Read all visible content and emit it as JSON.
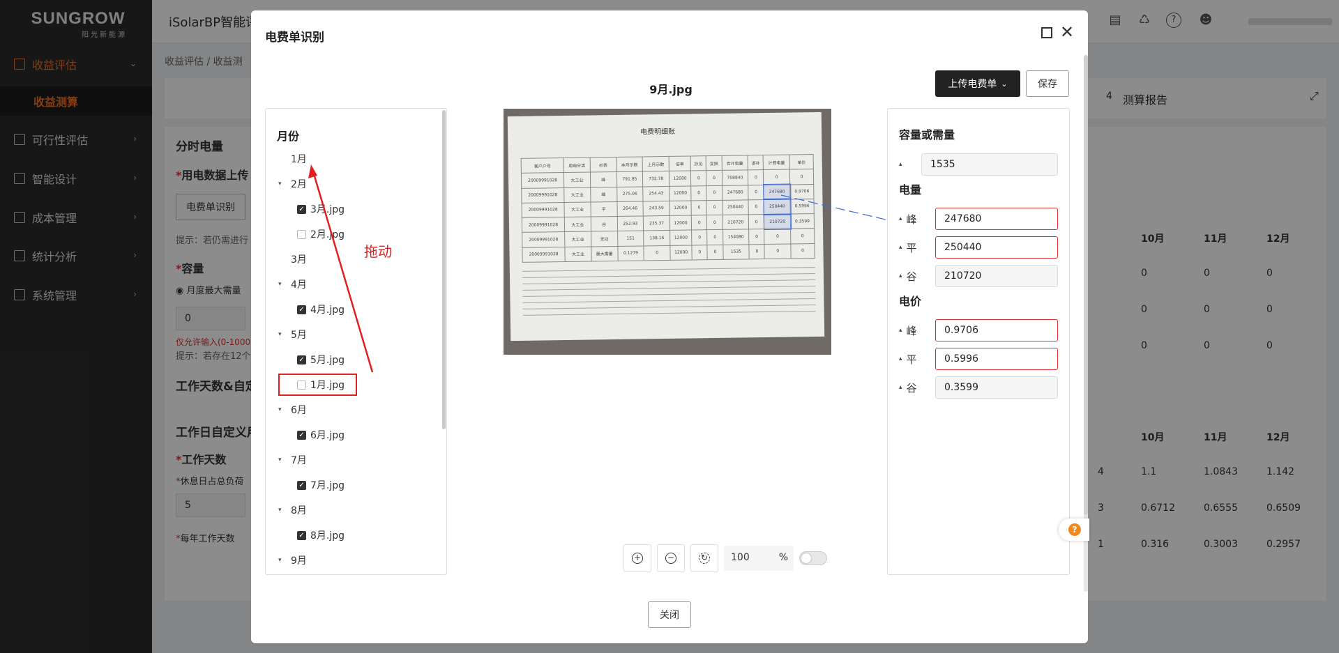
{
  "brand": {
    "name": "SUNGROW",
    "sub": "阳光新能源"
  },
  "sidebar": {
    "items": [
      {
        "label": "收益评估",
        "active": true
      },
      {
        "label": "可行性评估"
      },
      {
        "label": "智能设计"
      },
      {
        "label": "成本管理"
      },
      {
        "label": "统计分析"
      },
      {
        "label": "系统管理"
      }
    ],
    "subitem": "收益测算"
  },
  "header": {
    "app_title": "iSolarBP智能评估"
  },
  "background": {
    "breadcrumb": "收益评估  /  收益测",
    "step_label": "4",
    "step_title": "测算报告",
    "section_tou": "分时电量",
    "label_upload": "用电数据上传",
    "btn_bill": "电费单识别",
    "hint_retry": "提示：若仍需进行",
    "label_capacity": "容量",
    "radio_label": "月度最大需量",
    "capacity_value": "0",
    "err_range": "仅允许输入(0-1000",
    "hint_exists": "提示：若存在12个",
    "section_workdays": "工作天数&自定",
    "section_custom": "工作日自定义用",
    "label_workdays": "工作天数",
    "label_rest": "休息日占总负荷",
    "rest_value": "5",
    "label_yearly": "每年工作天数",
    "table1": {
      "headers": [
        "10月",
        "11月",
        "12月"
      ],
      "rows": [
        [
          "0",
          "0",
          "0"
        ],
        [
          "0",
          "0",
          "0"
        ],
        [
          "0",
          "0",
          "0"
        ]
      ]
    },
    "table2": {
      "headers": [
        "10月",
        "11月",
        "12月"
      ],
      "rows": [
        [
          "4",
          "1.1",
          "1.0843",
          "1.142"
        ],
        [
          "3",
          "0.6712",
          "0.6555",
          "0.6509"
        ],
        [
          "1",
          "0.316",
          "0.3003",
          "0.2957"
        ]
      ]
    }
  },
  "modal": {
    "title": "电费单识别",
    "upload_label": "上传电费单",
    "save_label": "保存",
    "close_label": "关闭",
    "image_name": "9月.jpg",
    "zoom_value": "100",
    "zoom_unit": "%",
    "tree": {
      "heading": "月份",
      "rows": [
        {
          "label": "1月",
          "type": "leaf-month"
        },
        {
          "label": "2月",
          "type": "group"
        },
        {
          "label": "3月.jpg",
          "type": "file",
          "checked": true
        },
        {
          "label": "2月.jpg",
          "type": "file",
          "checked": false
        },
        {
          "label": "3月",
          "type": "leaf-month"
        },
        {
          "label": "4月",
          "type": "group"
        },
        {
          "label": "4月.jpg",
          "type": "file",
          "checked": true
        },
        {
          "label": "5月",
          "type": "group"
        },
        {
          "label": "5月.jpg",
          "type": "file",
          "checked": true
        },
        {
          "label": "1月.jpg",
          "type": "file",
          "checked": false
        },
        {
          "label": "6月",
          "type": "group"
        },
        {
          "label": "6月.jpg",
          "type": "file",
          "checked": true
        },
        {
          "label": "7月",
          "type": "group"
        },
        {
          "label": "7月.jpg",
          "type": "file",
          "checked": true
        },
        {
          "label": "8月",
          "type": "group"
        },
        {
          "label": "8月.jpg",
          "type": "file",
          "checked": true
        },
        {
          "label": "9月",
          "type": "group"
        }
      ]
    },
    "right": {
      "capacity_heading": "容量或需量",
      "capacity_value": "1535",
      "energy_heading": "电量",
      "energy": [
        {
          "label": "峰",
          "value": "247680",
          "error": true
        },
        {
          "label": "平",
          "value": "250440",
          "error": true
        },
        {
          "label": "谷",
          "value": "210720",
          "error": false
        }
      ],
      "price_heading": "电价",
      "price": [
        {
          "label": "峰",
          "value": "0.9706",
          "error": true
        },
        {
          "label": "平",
          "value": "0.5996",
          "error": true
        },
        {
          "label": "谷",
          "value": "0.3599",
          "error": false
        }
      ]
    },
    "bill": {
      "title": "电费明细账",
      "rows": [
        [
          "客户户号",
          "用电分类",
          "抄表",
          "本月示数",
          "上月示数",
          "倍率",
          "抄见",
          "变损",
          "合计电量",
          "退补",
          "计费电量",
          "单价"
        ],
        [
          "20009991028",
          "大工业",
          "峰",
          "791.85",
          "732.78",
          "12000",
          "0",
          "0",
          "708840",
          "0",
          "0",
          "0"
        ],
        [
          "20009991028",
          "大工业",
          "峰",
          "275.06",
          "254.43",
          "12000",
          "0",
          "0",
          "247680",
          "0",
          "247680",
          "0.9706"
        ],
        [
          "20009991028",
          "大工业",
          "平",
          "264.46",
          "243.59",
          "12000",
          "0",
          "0",
          "250440",
          "0",
          "250440",
          "0.5996"
        ],
        [
          "20009991028",
          "大工业",
          "谷",
          "252.93",
          "235.37",
          "12000",
          "0",
          "0",
          "210720",
          "0",
          "210720",
          "0.3599"
        ],
        [
          "20009991028",
          "大工业",
          "无功",
          "151",
          "138.16",
          "12000",
          "0",
          "0",
          "154080",
          "0",
          "0",
          "0"
        ],
        [
          "20009991028",
          "大工业",
          "最大需量",
          "0.1279",
          "0",
          "12000",
          "0",
          "0",
          "1535",
          "0",
          "0",
          "0"
        ]
      ]
    }
  },
  "annotation": {
    "drag_text": "拖动"
  },
  "colors": {
    "accent": "#f37021",
    "error": "#e03030",
    "annotation": "#e02020"
  }
}
